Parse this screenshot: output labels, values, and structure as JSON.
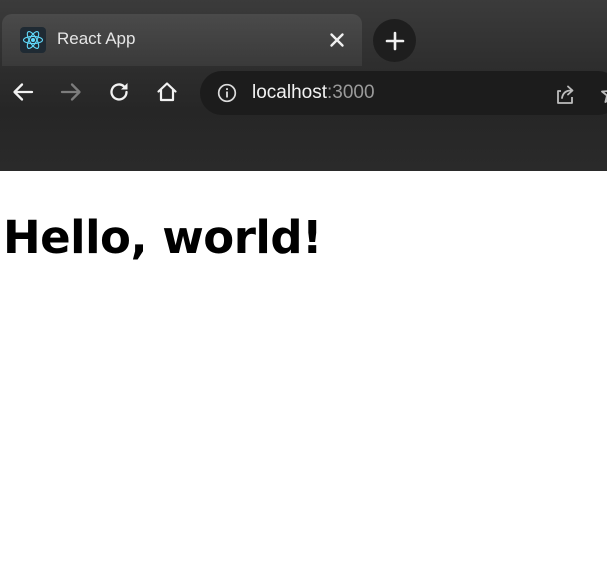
{
  "browser": {
    "tab": {
      "title": "React App",
      "favicon": "react-logo-icon",
      "close_icon": "close-icon"
    },
    "new_tab_icon": "plus-icon",
    "toolbar": {
      "back_icon": "arrow-left-icon",
      "forward_icon": "arrow-right-icon",
      "reload_icon": "reload-icon",
      "home_icon": "home-icon"
    },
    "omnibox": {
      "info_icon": "info-icon",
      "host": "localhost",
      "port": ":3000",
      "share_icon": "share-icon",
      "bookmark_icon": "star-icon"
    }
  },
  "page": {
    "heading": "Hello, world!"
  },
  "colors": {
    "chrome_dark": "#2e2e2e",
    "tab_active": "#404040",
    "react_cyan": "#61dafb",
    "page_background": "#ffffff"
  }
}
